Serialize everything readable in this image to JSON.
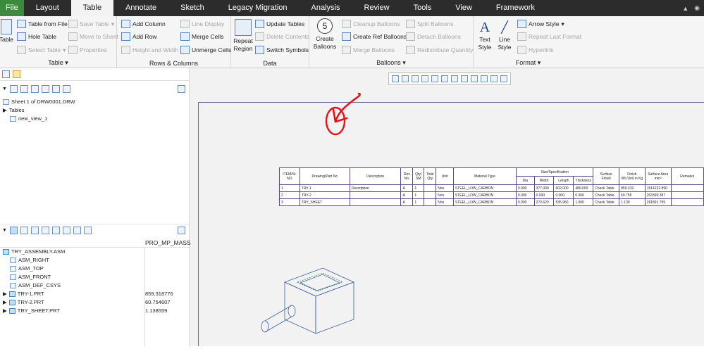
{
  "menubar": {
    "tabs": [
      "File",
      "Layout",
      "Table",
      "Annotate",
      "Sketch",
      "Legacy Migration",
      "Analysis",
      "Review",
      "Tools",
      "View",
      "Framework"
    ],
    "active": "Table"
  },
  "ribbon": {
    "table_group": {
      "label": "Table",
      "big": "Table",
      "table_from_file": "Table from File",
      "hole_table": "Hole Table",
      "select_table": "Select Table",
      "save_table": "Save Table",
      "move_to_sheet": "Move to Sheet",
      "properties": "Properties"
    },
    "rows_group": {
      "label": "Rows & Columns",
      "add_column": "Add Column",
      "add_row": "Add Row",
      "height_width": "Height and Width",
      "line_display": "Line Display",
      "merge_cells": "Merge Cells",
      "unmerge_cells": "Unmerge Cells"
    },
    "data_group": {
      "label": "Data",
      "repeat_region": "Repeat\nRegion",
      "update_tables": "Update Tables",
      "delete_contents": "Delete Contents",
      "switch_symbols": "Switch Symbols"
    },
    "balloons_group": {
      "label": "Balloons",
      "create_balloons": "Create\nBalloons",
      "balloon_number": "5",
      "cleanup_balloons": "Cleanup Balloons",
      "create_ref_balloons": "Create Ref Balloons",
      "merge_balloons": "Merge Balloons",
      "split_balloons": "Split Balloons",
      "detach_balloons": "Detach Balloons",
      "redistribute_quantity": "Redistribute Quantity"
    },
    "format_group": {
      "label": "Format",
      "text_style": "Text\nStyle",
      "line_style": "Line\nStyle",
      "arrow_style": "Arrow Style",
      "repeat_last_format": "Repeat Last Format",
      "hyperlink": "Hyperlink"
    }
  },
  "model_tree_top": {
    "sheet": "Sheet 1 of DRW0001.DRW",
    "tables": "Tables",
    "view": "new_view_1"
  },
  "model_tree_bottom": {
    "column_header": "PRO_MP_MASS",
    "rows": [
      {
        "name": "TRY_ASSEMBLY.ASM",
        "value": ""
      },
      {
        "name": "ASM_RIGHT",
        "value": ""
      },
      {
        "name": "ASM_TOP",
        "value": ""
      },
      {
        "name": "ASM_FRONT",
        "value": ""
      },
      {
        "name": "ASM_DEF_CSYS",
        "value": ""
      },
      {
        "name": "TRY-1.PRT",
        "value": "859.318776"
      },
      {
        "name": "TRY-2.PRT",
        "value": "60.754607"
      },
      {
        "name": "TRY_SHEET.PRT",
        "value": "1.138559"
      }
    ]
  },
  "bom": {
    "headers": {
      "item": "ITEM/Sr. NO",
      "drawing": "Drawing/Part No",
      "description": "Description",
      "rev": "Rev No.",
      "qty_sm": "Qty/ SM",
      "total_qty": "Total Qty",
      "unit": "Unit",
      "material": "Material Type",
      "size_spec": "Size/Specification",
      "dia": "Dia",
      "width": "Width",
      "length": "Length",
      "thickness": "Thickness",
      "surface_finish": "Surface Finish",
      "finish_wt": "Finish Wt./Unit in Kg",
      "surface_area": "Surface Area",
      "surface_area_unit": "mm²",
      "remarks": "Remarks"
    },
    "rows": [
      {
        "item": "1",
        "drawing": "TRY-1",
        "description": "Description",
        "rev": "A",
        "qty": "1",
        "total": "",
        "unit": "Nos",
        "material": "STEEL_LOW_CARBON",
        "dia": "0.000",
        "width": "377.000",
        "length": "602.000",
        "thickness": "489.000",
        "finish": "Check Table",
        "wt": "859.319",
        "area": "1514222.890",
        "remarks": ""
      },
      {
        "item": "2",
        "drawing": "TRY-2",
        "description": "",
        "rev": "A",
        "qty": "1",
        "total": "",
        "unit": "Nos",
        "material": "STEEL_LOW_CARBON",
        "dia": "0.000",
        "width": "0.000",
        "length": "0.000",
        "thickness": "0.000",
        "finish": "Check Table",
        "wt": "60.755",
        "area": "263399.387",
        "remarks": ""
      },
      {
        "item": "3",
        "drawing": "TRY_SHEET",
        "description": "",
        "rev": "A",
        "qty": "1",
        "total": "",
        "unit": "Nos",
        "material": "STEEL_LOW_CARBON",
        "dia": "0.000",
        "width": "270.620",
        "length": "535.960",
        "thickness": "1.000",
        "finish": "Check Table",
        "wt": "1.139",
        "area": "291891.799",
        "remarks": ""
      }
    ]
  },
  "colors": {
    "annotation": "#e8121a",
    "table_border": "#5a4a8a",
    "menubar": "#2c2c2c",
    "file_tab": "#3c8a3c"
  }
}
